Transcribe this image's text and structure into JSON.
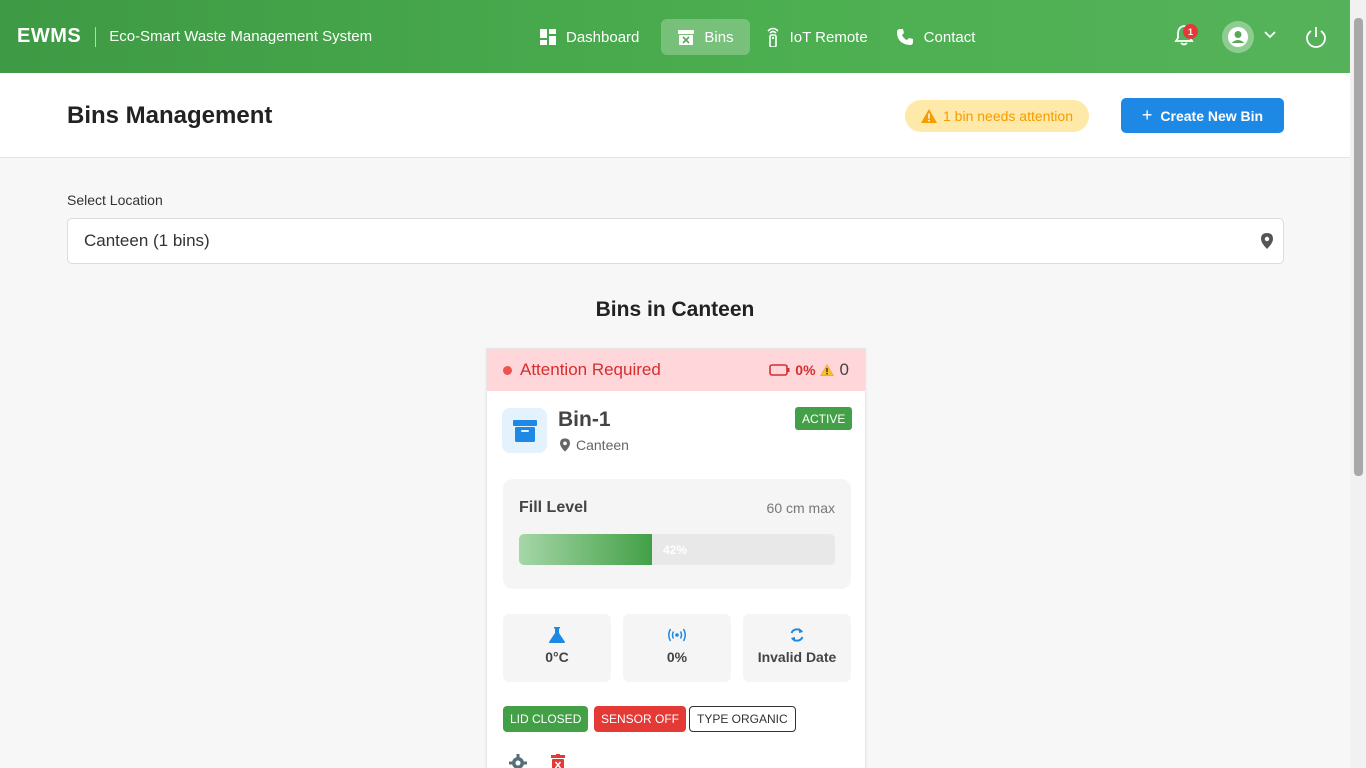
{
  "app": {
    "brand": "EWMS",
    "subtitle": "Eco-Smart Waste Management System"
  },
  "nav": {
    "items": [
      {
        "label": "Dashboard",
        "icon": "dashboard-icon"
      },
      {
        "label": "Bins",
        "icon": "bin-icon",
        "active": true
      },
      {
        "label": "IoT Remote",
        "icon": "remote-icon"
      },
      {
        "label": "Contact",
        "icon": "phone-icon"
      }
    ]
  },
  "notifications": {
    "count": "1"
  },
  "header": {
    "title": "Bins Management",
    "attention": "1 bin needs attention",
    "create_label": "Create New Bin"
  },
  "location": {
    "label": "Select Location",
    "selected": "Canteen (1 bins)"
  },
  "section": {
    "title": "Bins in Canteen"
  },
  "bin": {
    "alert_text": "Attention Required",
    "battery": "0%",
    "warnings": "0",
    "name": "Bin-1",
    "location": "Canteen",
    "status": "ACTIVE",
    "fill_label": "Fill Level",
    "fill_max": "60 cm max",
    "fill_percent": 42,
    "fill_text": "42%",
    "temperature": "0°C",
    "signal": "0%",
    "last_update": "Invalid Date",
    "chips": {
      "lid": "LID CLOSED",
      "sensor": "SENSOR OFF",
      "type": "TYPE ORGANIC"
    }
  },
  "colors": {
    "primary_green": "#4caf50",
    "accent_blue": "#1e88e5",
    "danger": "#e53935",
    "warning": "#f59c00"
  }
}
